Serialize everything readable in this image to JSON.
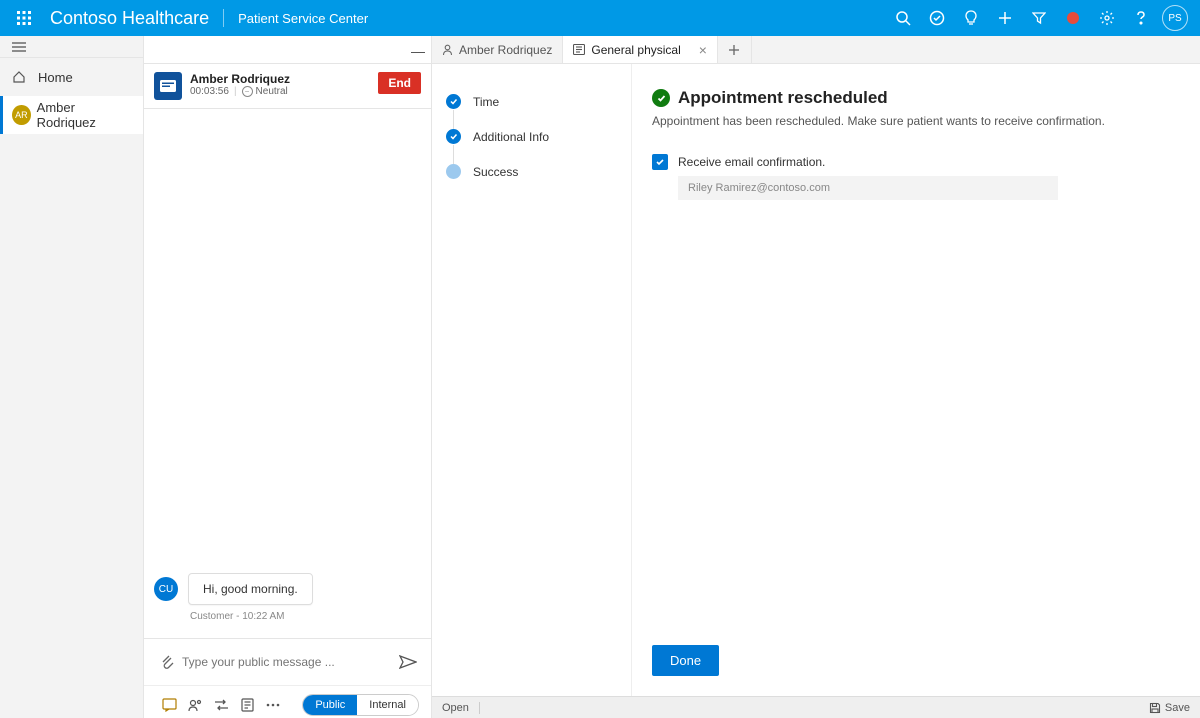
{
  "topbar": {
    "brand": "Contoso Healthcare",
    "subtitle": "Patient Service Center",
    "avatar_initials": "PS"
  },
  "nav": {
    "home_label": "Home",
    "patient_label": "Amber Rodriquez",
    "patient_initials": "AR"
  },
  "conv": {
    "name": "Amber Rodriquez",
    "timer": "00:03:56",
    "sentiment": "Neutral",
    "end_label": "End",
    "message_text": "Hi, good morning.",
    "message_avatar": "CU",
    "message_meta": "Customer - 10:22 AM",
    "compose_placeholder": "Type your public message ...",
    "seg_public": "Public",
    "seg_internal": "Internal"
  },
  "tabs": {
    "t1_label": "Amber Rodriquez",
    "t2_label": "General physical"
  },
  "steps": {
    "s1": "Time",
    "s2": "Additional Info",
    "s3": "Success"
  },
  "form": {
    "title": "Appointment rescheduled",
    "desc": "Appointment has been rescheduled. Make sure patient wants to receive confirmation.",
    "checkbox_label": "Receive email confirmation.",
    "email_value": "Riley Ramirez@contoso.com",
    "done_label": "Done"
  },
  "statusbar": {
    "open": "Open",
    "save": "Save"
  }
}
